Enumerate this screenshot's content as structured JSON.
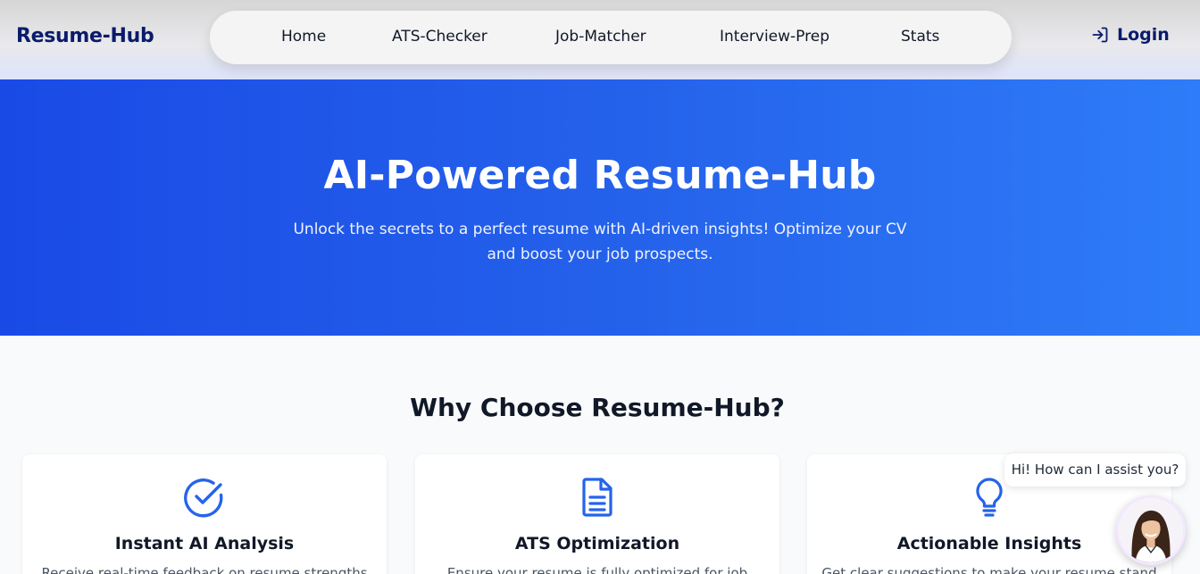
{
  "header": {
    "brand": "Resume-Hub",
    "nav": {
      "home": "Home",
      "ats": "ATS-Checker",
      "job": "Job-Matcher",
      "interview": "Interview-Prep",
      "stats": "Stats"
    },
    "login_label": "Login",
    "login_icon": "login-arrow-icon"
  },
  "hero": {
    "title": "AI-Powered Resume-Hub",
    "subtitle_line1": "Unlock the secrets to a perfect resume with AI-driven insights! Optimize your CV",
    "subtitle_line2": "and boost your job prospects."
  },
  "features": {
    "title": "Why Choose Resume-Hub?",
    "items": [
      {
        "icon": "check-circle-icon",
        "title": "Instant AI Analysis",
        "text": "Receive real-time feedback on resume strengths"
      },
      {
        "icon": "document-icon",
        "title": "ATS Optimization",
        "text": "Ensure your resume is fully optimized for job"
      },
      {
        "icon": "lightbulb-icon",
        "title": "Actionable Insights",
        "text": "Get clear suggestions to make your resume stand"
      }
    ]
  },
  "chat": {
    "greeting": "Hi! How can I assist you?",
    "avatar_icon": "assistant-avatar"
  },
  "colors": {
    "brand": "#0b1b6b",
    "accent": "#2563eb",
    "hero_start": "#1a4ae6",
    "hero_end": "#2e7cf9"
  }
}
